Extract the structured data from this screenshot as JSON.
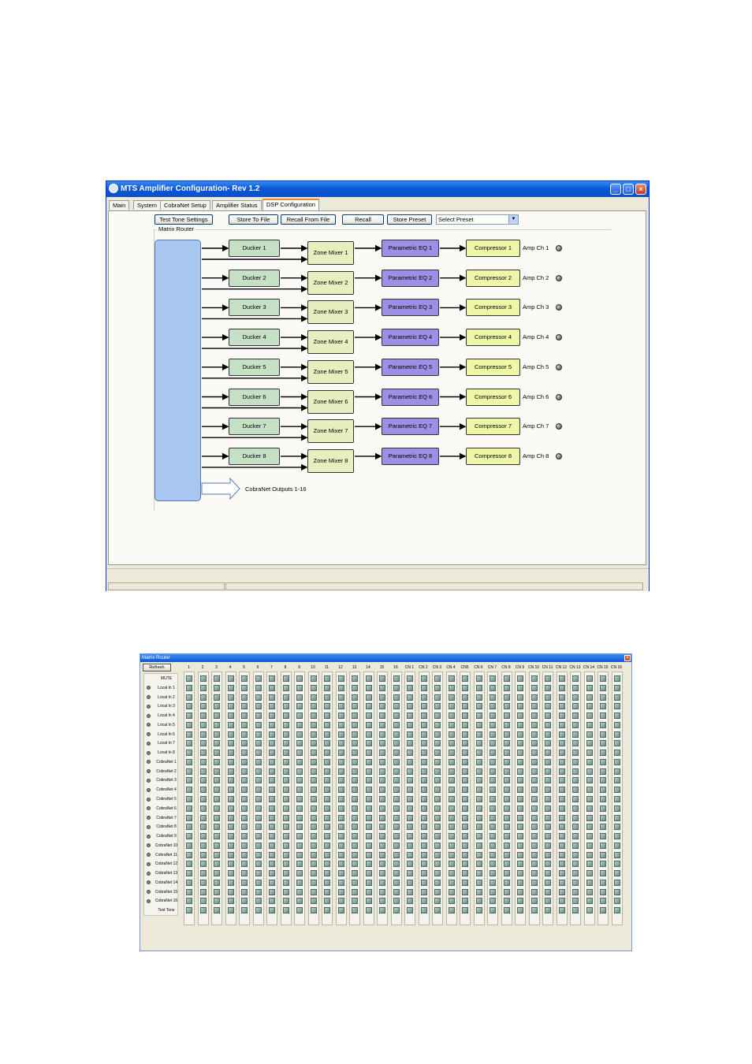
{
  "window": {
    "title": "MTS Amplifier Configuration- Rev 1.2",
    "tabs": [
      "Main",
      "System",
      "CobraNet Setup",
      "Amplifier Status",
      "DSP Configuration"
    ],
    "active_tab": "DSP Configuration"
  },
  "toolbar": {
    "test_tone": "Test Tone Settings",
    "store_file": "Store To File",
    "recall_file": "Recall From File",
    "recall": "Recall",
    "store_preset": "Store Preset",
    "preset_select": "Select Preset"
  },
  "router": {
    "group_label": "Matrix Router",
    "output_label": "CobraNet Outputs 1-16",
    "duckers": [
      "Ducker 1",
      "Ducker 2",
      "Ducker 3",
      "Ducker 4",
      "Ducker 5",
      "Ducker 6",
      "Ducker 7",
      "Ducker 8"
    ],
    "zone_mixers": [
      "Zone Mixer 1",
      "Zone Mixer 2",
      "Zone Mixer 3",
      "Zone Mixer 4",
      "Zone Mixer 5",
      "Zone Mixer 6",
      "Zone Mixer 7",
      "Zone Mixer 8"
    ],
    "peqs": [
      "Parametric EQ 1",
      "Parametric EQ 2",
      "Parametric EQ 3",
      "Parametric EQ 4",
      "Parametric EQ 5",
      "Parametric EQ 6",
      "Parametric EQ 7",
      "Parametric EQ 8"
    ],
    "compressors": [
      "Compressor 1",
      "Compressor 2",
      "Compressor 3",
      "Compressor 4",
      "Compressor 5",
      "Compressor 6",
      "Compressor 7",
      "Compressor 8"
    ],
    "amp_channels": [
      "Amp Ch 1",
      "Amp Ch 2",
      "Amp Ch 3",
      "Amp Ch 4",
      "Amp Ch 5",
      "Amp Ch 6",
      "Amp Ch 7",
      "Amp Ch 8"
    ]
  },
  "colors": {
    "ducker": "#c5e0c5",
    "zone_mixer": "#e8eec0",
    "peq": "#9c8fe6",
    "compressor": "#eef7a8",
    "matrix_block": "#a7c7f0"
  },
  "matrix": {
    "title": "Matrix Router",
    "refresh": "Refresh",
    "columns": [
      "1",
      "2",
      "3",
      "4",
      "5",
      "6",
      "7",
      "8",
      "9",
      "10",
      "11",
      "12",
      "13",
      "14",
      "15",
      "16",
      "CN 1",
      "CN 2",
      "CN 3",
      "CN 4",
      "CN5",
      "CN 6",
      "CN 7",
      "CN 8",
      "CN 9",
      "CN 10",
      "CN 11",
      "CN 12",
      "CN 13",
      "CN 14",
      "CN 15",
      "CN 16"
    ],
    "rows": [
      "MUTE",
      "Local In 1",
      "Local In 2",
      "Local In 3",
      "Local In 4",
      "Local In 5",
      "Local In 6",
      "Local In 7",
      "Local In 8",
      "CobraNet 1",
      "CobraNet 2",
      "CobraNet 3",
      "CobraNet 4",
      "CobraNet 5",
      "CobraNet 6",
      "CobraNet 7",
      "CobraNet 8",
      "CobraNet 9",
      "CobraNet 10",
      "CobraNet 11",
      "CobraNet 12",
      "CobraNet 13",
      "CobraNet 14",
      "CobraNet 15",
      "CobraNet 16",
      "Test Tone"
    ]
  }
}
